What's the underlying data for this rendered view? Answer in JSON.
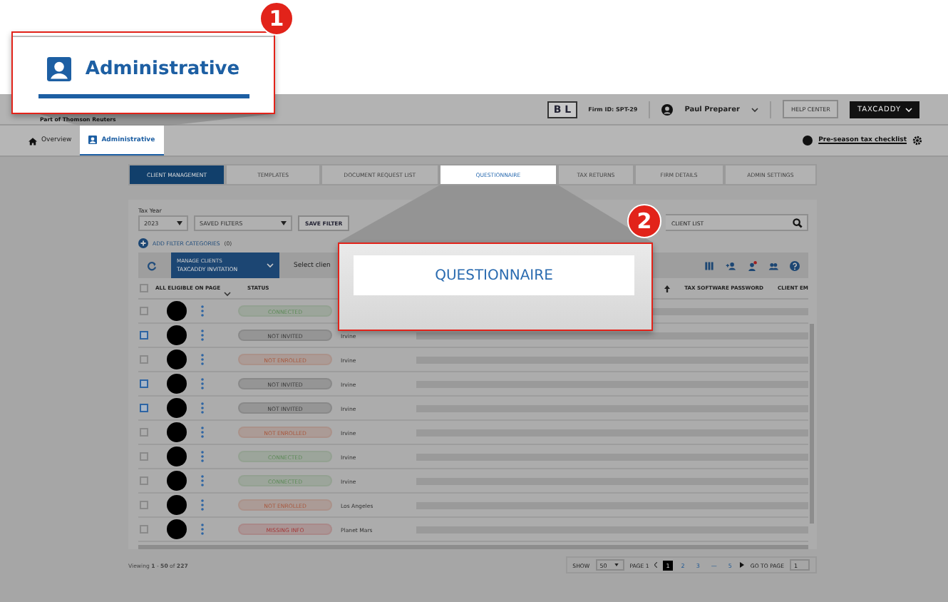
{
  "callouts": [
    {
      "number": "1",
      "label": "Administrative"
    },
    {
      "number": "2",
      "label": "QUESTIONNAIRE"
    }
  ],
  "header": {
    "tagline": "Part of Thomson Reuters",
    "firm_logo": "B L",
    "firm_id": "Firm ID: SPT-29",
    "user": "Paul Preparer",
    "help_button": "HELP CENTER",
    "app_button": "TAXCADDY"
  },
  "nav": {
    "items": [
      {
        "label": "Overview",
        "selected": false,
        "highlighted": false
      },
      {
        "label": "Administrative",
        "selected": true,
        "highlighted": true
      }
    ],
    "checklist_link": "Pre-season tax checklist"
  },
  "tabs": [
    {
      "label": "CLIENT MANAGEMENT",
      "selected": true,
      "highlighted": false
    },
    {
      "label": "TEMPLATES",
      "selected": false,
      "highlighted": false
    },
    {
      "label": "DOCUMENT REQUEST LIST",
      "selected": false,
      "highlighted": false
    },
    {
      "label": "QUESTIONNAIRE",
      "selected": false,
      "highlighted": true
    },
    {
      "label": "TAX RETURNS",
      "selected": false,
      "highlighted": false
    },
    {
      "label": "FIRM DETAILS",
      "selected": false,
      "highlighted": false
    },
    {
      "label": "ADMIN SETTINGS",
      "selected": false,
      "highlighted": false
    }
  ],
  "filters": {
    "tax_year_label": "Tax Year",
    "tax_year": "2023",
    "saved_filters": "SAVED FILTERS",
    "save_button": "SAVE FILTER",
    "search_placeholder": "CLIENT LIST",
    "add_categories": "ADD FILTER CATEGORIES",
    "category_count": "(0)"
  },
  "toolbar": {
    "action_label": "MANAGE CLIENTS",
    "action_value": "TAXCADDY INVITATION",
    "select_hint": "Select clien"
  },
  "table": {
    "all_selected": false,
    "columns": [
      "ALL ELIGIBLE ON PAGE",
      "STATUS",
      "TAX SOFTWARE PASSWORD",
      "CLIENT EM"
    ],
    "rows": [
      {
        "selected": false,
        "status": "CONNECTED",
        "color": "#5f8a5a"
      },
      {
        "selected": true,
        "status": "NOT INVITED",
        "color": "#3a3a3a",
        "city": "Irvine"
      },
      {
        "selected": false,
        "status": "NOT ENROLLED",
        "color": "#a8593f",
        "city": "Irvine"
      },
      {
        "selected": true,
        "status": "NOT INVITED",
        "color": "#3a3a3a",
        "city": "Irvine"
      },
      {
        "selected": true,
        "status": "NOT INVITED",
        "color": "#3a3a3a",
        "city": "Irvine"
      },
      {
        "selected": false,
        "status": "NOT ENROLLED",
        "color": "#a8593f",
        "city": "Irvine"
      },
      {
        "selected": false,
        "status": "CONNECTED",
        "color": "#5f8a5a",
        "city": "Irvine"
      },
      {
        "selected": false,
        "status": "CONNECTED",
        "color": "#5f8a5a",
        "city": "Irvine"
      },
      {
        "selected": false,
        "status": "NOT ENROLLED",
        "color": "#a8593f",
        "city": "Los Angeles"
      },
      {
        "selected": false,
        "status": "MISSING INFO",
        "color": "#a33a3a",
        "city": "Planet Mars"
      }
    ]
  },
  "footer": {
    "viewing": "Viewing **1** - **50** of **227**",
    "show_label": "SHOW",
    "page_size": "50",
    "page_label": "PAGE 1",
    "pages": [
      {
        "label": "1",
        "selected": true
      },
      {
        "label": "2",
        "selected": false
      },
      {
        "label": "3",
        "selected": false
      },
      {
        "label": "—",
        "selected": false
      },
      {
        "label": "5",
        "selected": false
      }
    ],
    "goto_label": "GO TO PAGE",
    "goto_value": "1"
  }
}
